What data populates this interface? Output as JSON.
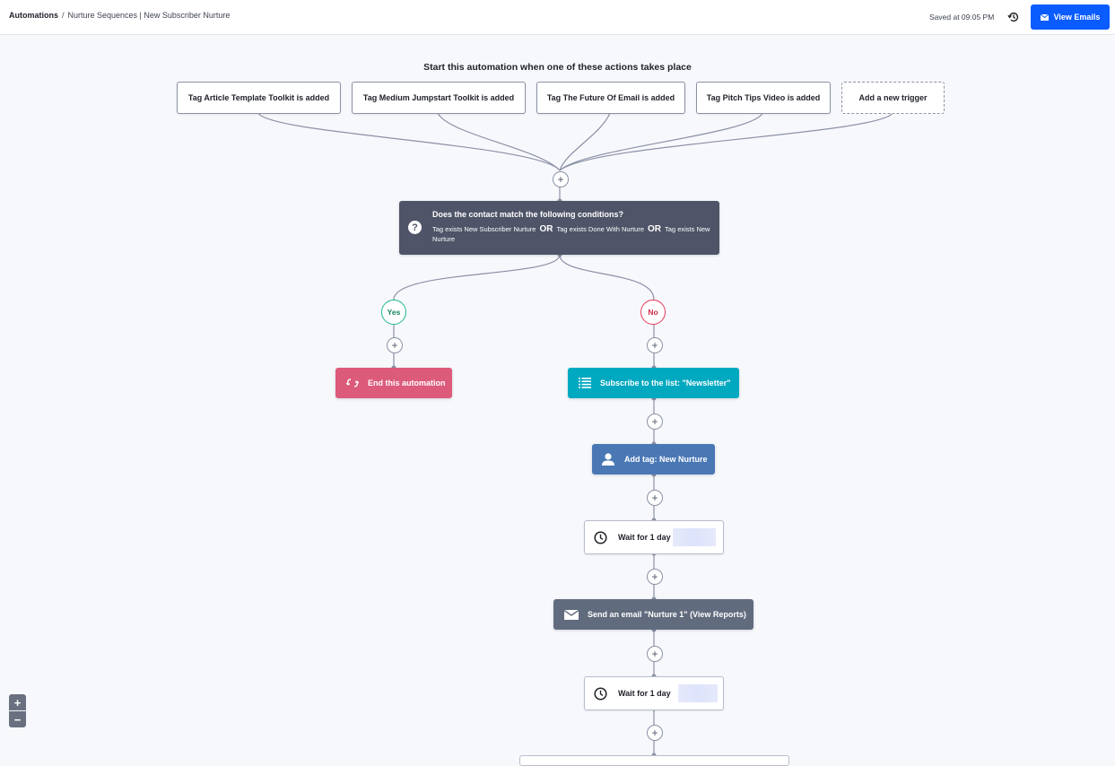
{
  "header": {
    "breadcrumb_root": "Automations",
    "breadcrumb_separator": "/",
    "breadcrumb_current": "Nurture Sequences | New Subscriber Nurture",
    "saved_status": "Saved at 09:05 PM",
    "history_icon": "history-icon",
    "view_emails_label": "View Emails",
    "view_emails_icon": "envelope-icon",
    "accent_color": "#0b5cff"
  },
  "workflow": {
    "trigger_heading": "Start this automation when one of these actions takes place",
    "triggers": [
      {
        "label": "Tag Article Template Toolkit is added"
      },
      {
        "label": "Tag Medium Jumpstart Toolkit is added"
      },
      {
        "label": "Tag The Future Of Email is added"
      },
      {
        "label": "Tag Pitch Tips Video is added"
      }
    ],
    "add_trigger_label": "Add a new trigger",
    "plus_symbol": "+",
    "condition": {
      "title": "Does the contact match the following conditions?",
      "icon": "question-icon",
      "clauses": [
        "Tag exists New Subscriber Nurture",
        "Tag exists Done With Nurture",
        "Tag exists New Nurture"
      ],
      "operator": "OR"
    },
    "yes_label": "Yes",
    "no_label": "No",
    "yes_branch": [
      {
        "type": "end",
        "label": "End this automation",
        "icon": "loop-arrows-icon",
        "color": "#dc5a7a"
      }
    ],
    "no_branch": [
      {
        "type": "subscribe",
        "label": "Subscribe to the list: \"Newsletter\"",
        "icon": "list-icon",
        "color": "#00a8c0"
      },
      {
        "type": "add_tag",
        "label": "Add tag: New Nurture",
        "icon": "user-icon",
        "color": "#4a78b5"
      },
      {
        "type": "wait",
        "label": "Wait for 1 day",
        "icon": "clock-icon"
      },
      {
        "type": "send_email",
        "label": "Send an email \"Nurture 1\" (View Reports)",
        "icon": "envelope-icon",
        "color": "#616b7e"
      },
      {
        "type": "wait",
        "label": "Wait for 1 day",
        "icon": "clock-icon"
      }
    ]
  },
  "zoom_controls": {
    "zoom_in": "+",
    "zoom_out": "−"
  }
}
